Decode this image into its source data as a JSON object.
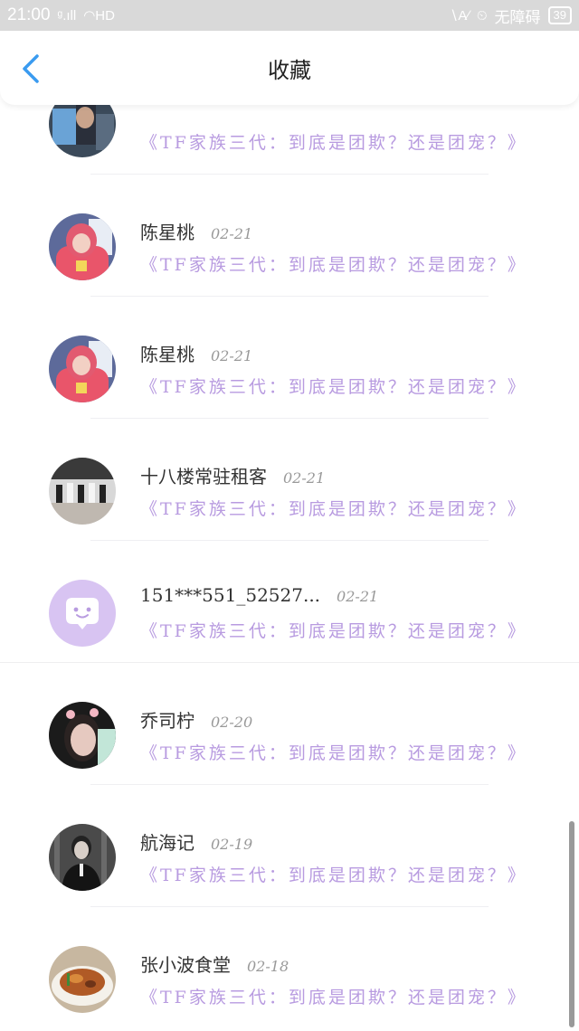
{
  "status_bar": {
    "time": "21:00",
    "signal": "ᵍ.ıll",
    "wifi": "◠HD",
    "vpn": "∖A∕",
    "alarm": "⏲",
    "accessibility": "无障碍",
    "battery": "39"
  },
  "header": {
    "back_icon": "chevron-left-icon",
    "title": "收藏"
  },
  "favorites": [
    {
      "author": "",
      "date": "",
      "title": "《TF家族三代：到底是团欺？还是团宠？》"
    },
    {
      "author": "陈星桃",
      "date": "02-21",
      "title": "《TF家族三代：到底是团欺？还是团宠？》"
    },
    {
      "author": "陈星桃",
      "date": "02-21",
      "title": "《TF家族三代：到底是团欺？还是团宠？》"
    },
    {
      "author": "十八楼常驻租客",
      "date": "02-21",
      "title": "《TF家族三代：到底是团欺？还是团宠？》"
    },
    {
      "author": "151***551_52527...",
      "date": "02-21",
      "title": "《TF家族三代：到底是团欺？还是团宠？》"
    },
    {
      "author": "乔司柠",
      "date": "02-20",
      "title": "《TF家族三代：到底是团欺？还是团宠？》"
    },
    {
      "author": "航海记",
      "date": "02-19",
      "title": "《TF家族三代：到底是团欺？还是团宠？》"
    },
    {
      "author": "张小波食堂",
      "date": "02-18",
      "title": "《TF家族三代：到底是团欺？还是团宠？》"
    }
  ],
  "colors": {
    "accent_blue": "#3a9bf0",
    "title_purple": "#b89be0",
    "default_avatar_bg": "#d8c4f2"
  }
}
